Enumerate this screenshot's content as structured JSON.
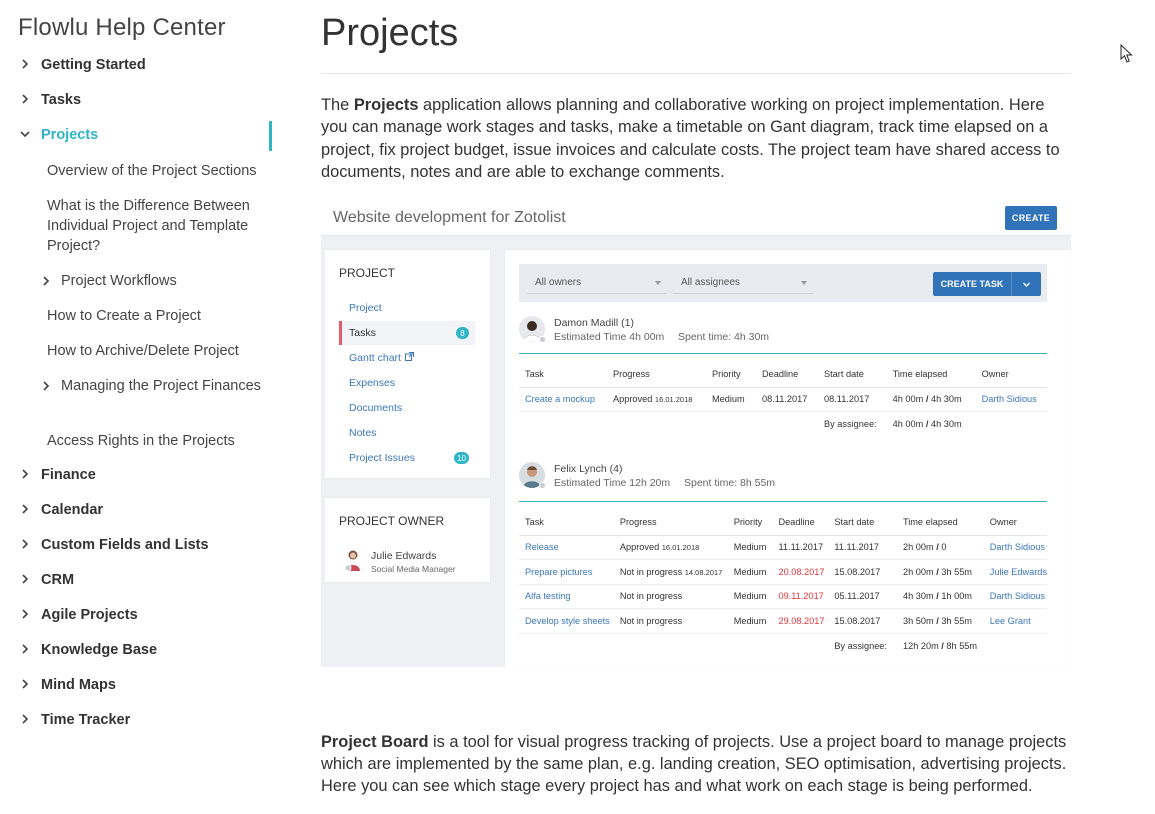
{
  "sidebar": {
    "brand": "Flowlu Help Center",
    "items": [
      {
        "label": "Getting Started"
      },
      {
        "label": "Tasks"
      },
      {
        "label": "Projects"
      },
      {
        "label": "Finance"
      },
      {
        "label": "Calendar"
      },
      {
        "label": "Custom Fields and Lists"
      },
      {
        "label": "CRM"
      },
      {
        "label": "Agile Projects"
      },
      {
        "label": "Knowledge Base"
      },
      {
        "label": "Mind Maps"
      },
      {
        "label": "Time Tracker"
      }
    ],
    "projects_sub": [
      {
        "label": "Overview of the Project Sections"
      },
      {
        "label": "What is the Difference Between Individual Project and Template Project?"
      },
      {
        "label": "Project Workflows"
      },
      {
        "label": "How to Create a Project"
      },
      {
        "label": "How to Archive/Delete Project"
      },
      {
        "label": "Managing the Project Finances"
      },
      {
        "label": "Access Rights in the Projects"
      }
    ]
  },
  "main": {
    "title": "Projects",
    "intro": {
      "pre": "The ",
      "bold": "Projects",
      "post": " application allows planning and collaborative working on project implementation. Here you can manage work stages and tasks, make a timetable on Gant diagram, track time elapsed on a project, fix project budget, issue invoices and calculate costs. The project team have shared access to documents, notes and are able to exchange comments."
    },
    "outro": {
      "bold": "Project Board",
      "post": " is a tool for visual progress tracking of projects. Use a project board to manage projects which are implemented by the same plan, e.g. landing creation, SEO optimisation, advertising projects. Here you can see which stage every project has and what work on each stage is being performed."
    }
  },
  "shot": {
    "title": "Website development for Zotolist",
    "create": "CREATE",
    "project_head": "PROJECT",
    "menu": [
      {
        "label": "Project"
      },
      {
        "label": "Tasks",
        "badge": "8"
      },
      {
        "label": "Gantt chart"
      },
      {
        "label": "Expenses"
      },
      {
        "label": "Documents"
      },
      {
        "label": "Notes"
      },
      {
        "label": "Project Issues",
        "badge": "10"
      }
    ],
    "owner_head": "PROJECT OWNER",
    "owner_name": "Julie Edwards",
    "owner_role": "Social Media Manager",
    "filter_owners": "All owners",
    "filter_assignees": "All assignees",
    "create_task": "CREATE TASK",
    "headers": [
      "Task",
      "Progress",
      "Priority",
      "Deadline",
      "Start date",
      "Time elapsed",
      "Owner"
    ],
    "by_assignee": "By assignee:",
    "groups": [
      {
        "name": "Damon Madill (1)",
        "estimated": "Estimated Time 4h 00m",
        "spent": "Spent time: 4h 30m",
        "rows": [
          {
            "task": "Create a mockup",
            "progress": "Approved",
            "progress_date": "16.01.2018",
            "priority": "Medium",
            "deadline": "08.11.2017",
            "start": "08.11.2017",
            "elapsed_a": "4h 00m",
            "elapsed_b": "4h 30m",
            "owner": "Darth Sidious",
            "late": false
          }
        ],
        "sum_a": "4h 00m",
        "sum_b": "4h 30m"
      },
      {
        "name": "Felix Lynch (4)",
        "estimated": "Estimated Time 12h 20m",
        "spent": "Spent time: 8h 55m",
        "rows": [
          {
            "task": "Release",
            "progress": "Approved",
            "progress_date": "16.01.2018",
            "priority": "Medium",
            "deadline": "11.11.2017",
            "start": "11.11.2017",
            "elapsed_a": "2h 00m",
            "elapsed_b": "0",
            "owner": "Darth Sidious",
            "late": false
          },
          {
            "task": "Prepare pictures",
            "progress": "Not in progress",
            "progress_date": "14.08.2017",
            "priority": "Medium",
            "deadline": "20.08.2017",
            "start": "15.08.2017",
            "elapsed_a": "2h 00m",
            "elapsed_b": "3h 55m",
            "owner": "Julie Edwards",
            "late": true
          },
          {
            "task": "Alfa testing",
            "progress": "Not in progress",
            "progress_date": "",
            "priority": "Medium",
            "deadline": "09.11.2017",
            "start": "05.11.2017",
            "elapsed_a": "4h 30m",
            "elapsed_b": "1h 00m",
            "owner": "Darth Sidious",
            "late": true
          },
          {
            "task": "Develop style sheets",
            "progress": "Not in progress",
            "progress_date": "",
            "priority": "Medium",
            "deadline": "29.08.2017",
            "start": "15.08.2017",
            "elapsed_a": "3h 50m",
            "elapsed_b": "3h 55m",
            "owner": "Lee Grant",
            "late": true
          }
        ],
        "sum_a": "12h 20m",
        "sum_b": "8h 55m"
      }
    ]
  }
}
